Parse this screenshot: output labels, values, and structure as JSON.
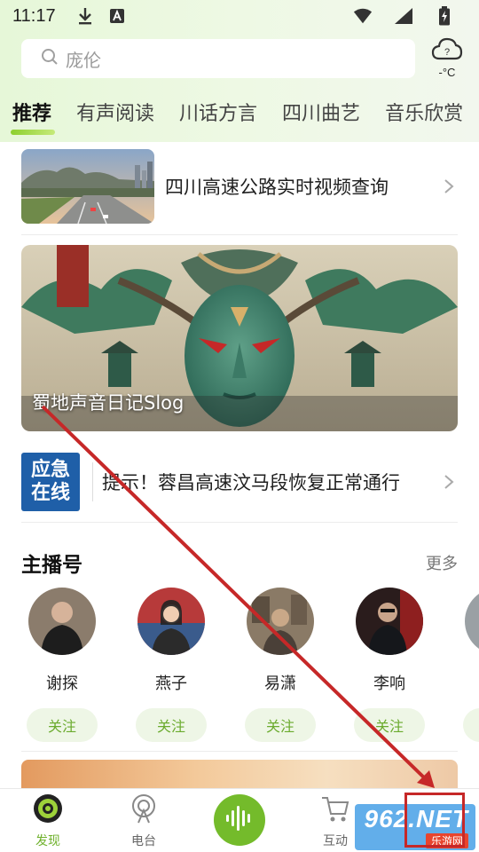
{
  "status_bar": {
    "time": "11:17"
  },
  "search": {
    "placeholder": "庞伦"
  },
  "weather": {
    "temp": "-°C"
  },
  "tabs": [
    "推荐",
    "有声阅读",
    "川话方言",
    "四川曲艺",
    "音乐欣赏"
  ],
  "active_tab": "推荐",
  "feed": {
    "highway": {
      "title": "四川高速公路实时视频查询"
    },
    "banner": {
      "caption": "蜀地声音日记Slog"
    },
    "notice": {
      "logo_line1": "应急",
      "logo_line2": "在线",
      "title": "提示！蓉昌高速汶马段恢复正常通行"
    }
  },
  "hosts_section": {
    "title": "主播号",
    "more": "更多",
    "follow_label": "关注",
    "hosts": [
      {
        "name": "谢探"
      },
      {
        "name": "燕子"
      },
      {
        "name": "易潇"
      },
      {
        "name": "李响"
      }
    ]
  },
  "tabbar": {
    "discover": "发现",
    "radio": "电台",
    "interact": "互动"
  },
  "watermark": {
    "main": "962.NET",
    "sub": "乐游网"
  },
  "colors": {
    "accent": "#74bb2b",
    "follow_bg": "#eef6e6",
    "follow_text": "#6bab2e",
    "annotation": "#c62828"
  }
}
